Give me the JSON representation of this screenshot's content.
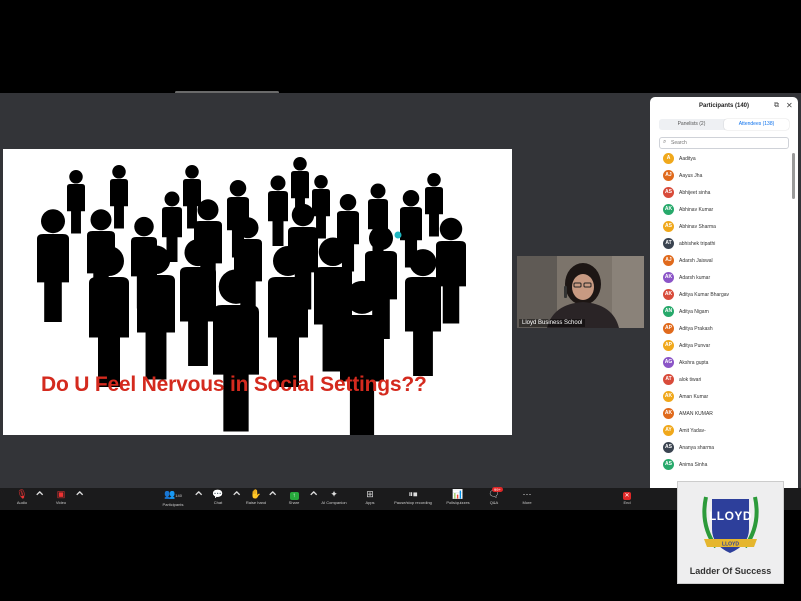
{
  "slide": {
    "title": "Do U Feel Nervous in Social Settings??"
  },
  "camera": {
    "name": "Lloyd Business School"
  },
  "participants_panel": {
    "title": "Participants (140)",
    "tabs": [
      "Panelists (2)",
      "Attendees (138)"
    ],
    "search_placeholder": "Search",
    "people": [
      {
        "initials": "A",
        "name": "Aaditya",
        "color": "#f0a81b"
      },
      {
        "initials": "AJ",
        "name": "Aayus Jha",
        "color": "#e06a1c"
      },
      {
        "initials": "AS",
        "name": "Abhijeet sinha",
        "color": "#d84b3a"
      },
      {
        "initials": "AK",
        "name": "Abhinav Kumar",
        "color": "#27a96b"
      },
      {
        "initials": "AS",
        "name": "Abhinav Sharma",
        "color": "#f0a81b"
      },
      {
        "initials": "AT",
        "name": "abhishek tripathi",
        "color": "#3a4350"
      },
      {
        "initials": "AJ",
        "name": "Adarsh Jaiswal",
        "color": "#e06a1c"
      },
      {
        "initials": "AK",
        "name": "Adarsh kumar",
        "color": "#8b55c7"
      },
      {
        "initials": "AK",
        "name": "Aditya Kumar Bhargav",
        "color": "#d84b3a"
      },
      {
        "initials": "AN",
        "name": "Aditya Nigam",
        "color": "#27a96b"
      },
      {
        "initials": "AP",
        "name": "Aditya Prakash",
        "color": "#e06a1c"
      },
      {
        "initials": "AP",
        "name": "Aditya Punvar",
        "color": "#f0a81b"
      },
      {
        "initials": "AG",
        "name": "Akshra gupta",
        "color": "#8b55c7"
      },
      {
        "initials": "AT",
        "name": "alok tiwari",
        "color": "#d84b3a"
      },
      {
        "initials": "AK",
        "name": "Aman Kumar",
        "color": "#f0a81b"
      },
      {
        "initials": "AK",
        "name": "AMAN KUMAR",
        "color": "#e06a1c"
      },
      {
        "initials": "AY",
        "name": "Amit Yadav-",
        "color": "#f0a81b"
      },
      {
        "initials": "AS",
        "name": "Ananya sharma",
        "color": "#3a4350"
      },
      {
        "initials": "AS",
        "name": "Anima Sinha",
        "color": "#27a96b"
      }
    ]
  },
  "toolbar": {
    "audio": "Audio",
    "video": "Video",
    "participants": "Participants",
    "participants_count": "140",
    "chat": "Chat",
    "raise_hand": "Raise hand",
    "share": "Share",
    "ai_companion": "AI Companion",
    "apps": "Apps",
    "recording": "Pause/stop recording",
    "polls": "Polls/quizzes",
    "qa": "Q&A",
    "qa_badge": "99+",
    "more": "More",
    "end": "End"
  },
  "logo": {
    "brand": "LLOYD",
    "ribbon": "LLOYD",
    "tagline": "Ladder Of Success"
  },
  "colors": {
    "accent": "#0e72ed",
    "title_red": "#d42a1e",
    "logo_blue": "#2d3f9b",
    "logo_green": "#2c9a3a",
    "logo_gold": "#e5b62e"
  }
}
